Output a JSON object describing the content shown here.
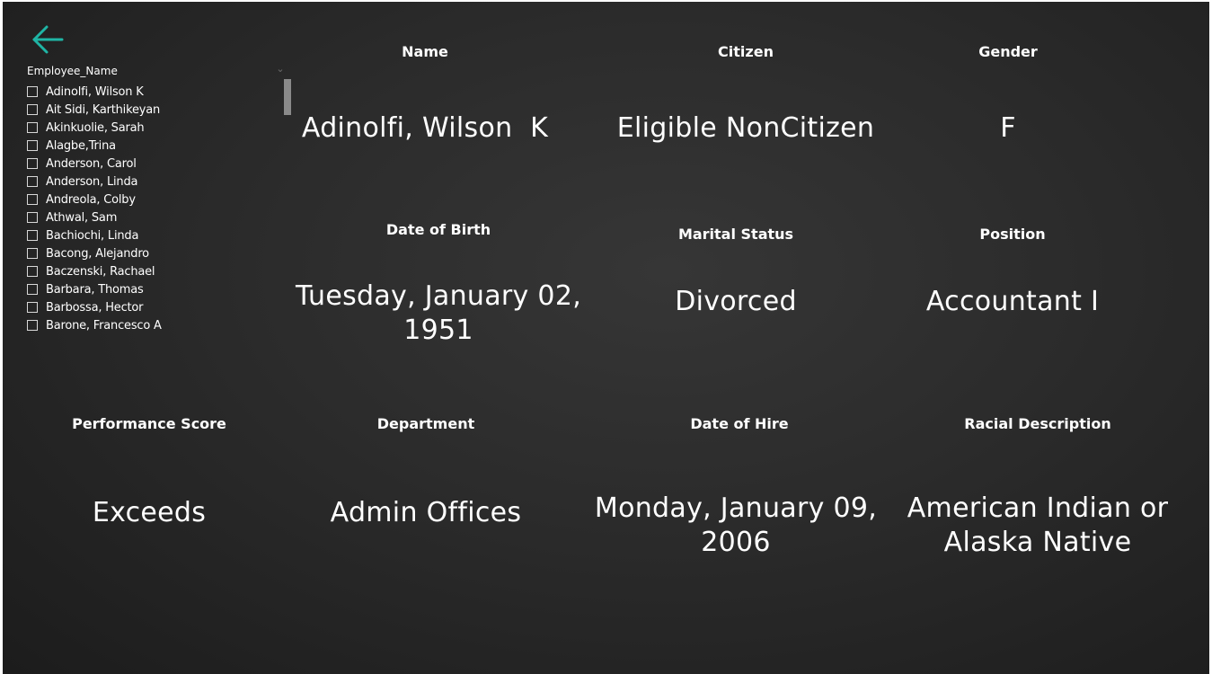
{
  "navigation": {
    "back_icon": "arrow-left-icon",
    "accent_color": "#1fb5a5"
  },
  "slicer": {
    "title": "Employee_Name",
    "chevron_icon": "chevron-down-icon",
    "items": [
      {
        "label": "Adinolfi, Wilson K",
        "checked": false
      },
      {
        "label": "Ait Sidi, Karthikeyan",
        "checked": false
      },
      {
        "label": "Akinkuolie, Sarah",
        "checked": false
      },
      {
        "label": "Alagbe,Trina",
        "checked": false
      },
      {
        "label": "Anderson, Carol",
        "checked": false
      },
      {
        "label": "Anderson, Linda",
        "checked": false
      },
      {
        "label": "Andreola, Colby",
        "checked": false
      },
      {
        "label": "Athwal, Sam",
        "checked": false
      },
      {
        "label": "Bachiochi, Linda",
        "checked": false
      },
      {
        "label": "Bacong, Alejandro",
        "checked": false
      },
      {
        "label": "Baczenski, Rachael",
        "checked": false
      },
      {
        "label": "Barbara, Thomas",
        "checked": false
      },
      {
        "label": "Barbossa, Hector",
        "checked": false
      },
      {
        "label": "Barone, Francesco A",
        "checked": false
      }
    ]
  },
  "cards": {
    "name": {
      "label": "Name",
      "value": "Adinolfi, Wilson  K"
    },
    "citizen": {
      "label": "Citizen",
      "value": "Eligible NonCitizen"
    },
    "gender": {
      "label": "Gender",
      "value": "F"
    },
    "dob": {
      "label": "Date of Birth",
      "value_line1": "Tuesday, January 02,",
      "value_line2": "1951"
    },
    "marital": {
      "label": "Marital Status",
      "value": "Divorced"
    },
    "position": {
      "label": "Position",
      "value": "Accountant I"
    },
    "performance": {
      "label": "Performance Score",
      "value": "Exceeds"
    },
    "department": {
      "label": "Department",
      "value": "Admin Offices"
    },
    "hire": {
      "label": "Date of Hire",
      "value_line1": "Monday, January 09,",
      "value_line2": "2006"
    },
    "race": {
      "label": "Racial Description",
      "value_line1": "American Indian or",
      "value_line2": "Alaska Native"
    }
  }
}
